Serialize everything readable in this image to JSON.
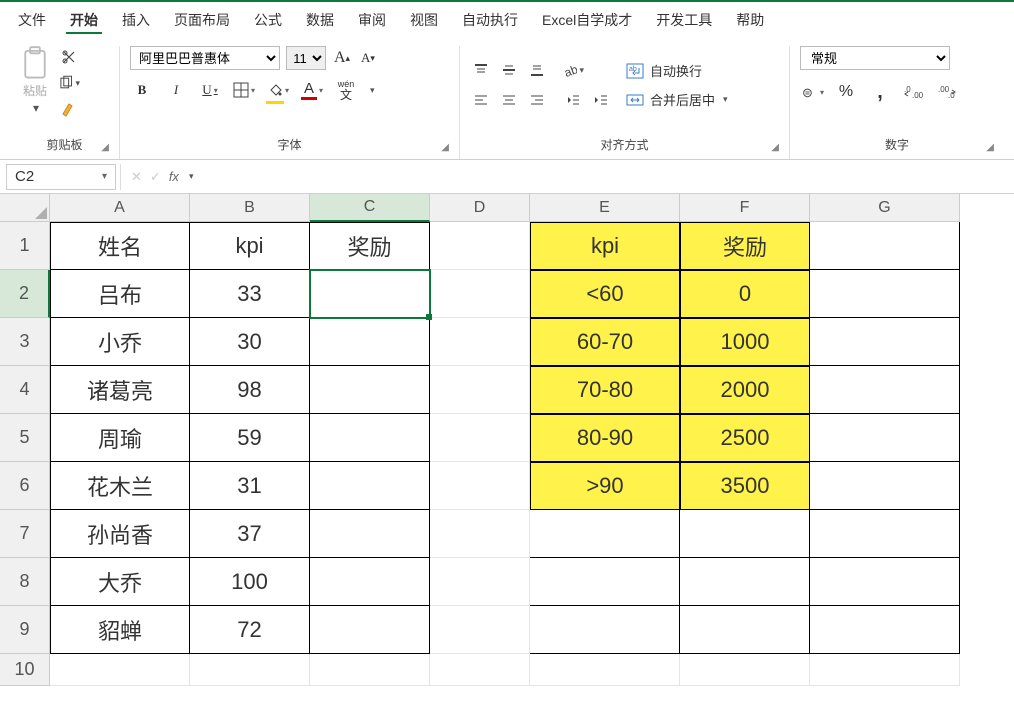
{
  "menu": {
    "items": [
      "文件",
      "开始",
      "插入",
      "页面布局",
      "公式",
      "数据",
      "审阅",
      "视图",
      "自动执行",
      "Excel自学成才",
      "开发工具",
      "帮助"
    ],
    "active_index": 1
  },
  "ribbon": {
    "clipboard": {
      "paste_label": "粘贴",
      "group_label": "剪贴板"
    },
    "font": {
      "font_name": "阿里巴巴普惠体",
      "font_size": "11",
      "group_label": "字体",
      "wen_label": "wén",
      "wen_sub": "文"
    },
    "alignment": {
      "wrap_label": "自动换行",
      "merge_label": "合并后居中",
      "group_label": "对齐方式"
    },
    "number": {
      "format": "常规",
      "group_label": "数字"
    }
  },
  "formula_bar": {
    "cell_ref": "C2",
    "formula": ""
  },
  "columns": [
    "A",
    "B",
    "C",
    "D",
    "E",
    "F",
    "G"
  ],
  "rows": [
    "1",
    "2",
    "3",
    "4",
    "5",
    "6",
    "7",
    "8",
    "9",
    "10"
  ],
  "active": {
    "col": "C",
    "row": "2"
  },
  "main_table": {
    "headers": {
      "name": "姓名",
      "kpi": "kpi",
      "reward": "奖励"
    },
    "rows": [
      {
        "name": "吕布",
        "kpi": "33",
        "reward": ""
      },
      {
        "name": "小乔",
        "kpi": "30",
        "reward": ""
      },
      {
        "name": "诸葛亮",
        "kpi": "98",
        "reward": ""
      },
      {
        "name": "周瑜",
        "kpi": "59",
        "reward": ""
      },
      {
        "name": "花木兰",
        "kpi": "31",
        "reward": ""
      },
      {
        "name": "孙尚香",
        "kpi": "37",
        "reward": ""
      },
      {
        "name": "大乔",
        "kpi": "100",
        "reward": ""
      },
      {
        "name": "貂蝉",
        "kpi": "72",
        "reward": ""
      }
    ]
  },
  "ref_table": {
    "headers": {
      "kpi": "kpi",
      "reward": "奖励"
    },
    "rows": [
      {
        "kpi": "<60",
        "reward": "0"
      },
      {
        "kpi": "60-70",
        "reward": "1000"
      },
      {
        "kpi": "70-80",
        "reward": "2000"
      },
      {
        "kpi": "80-90",
        "reward": "2500"
      },
      {
        "kpi": ">90",
        "reward": "3500"
      }
    ]
  }
}
